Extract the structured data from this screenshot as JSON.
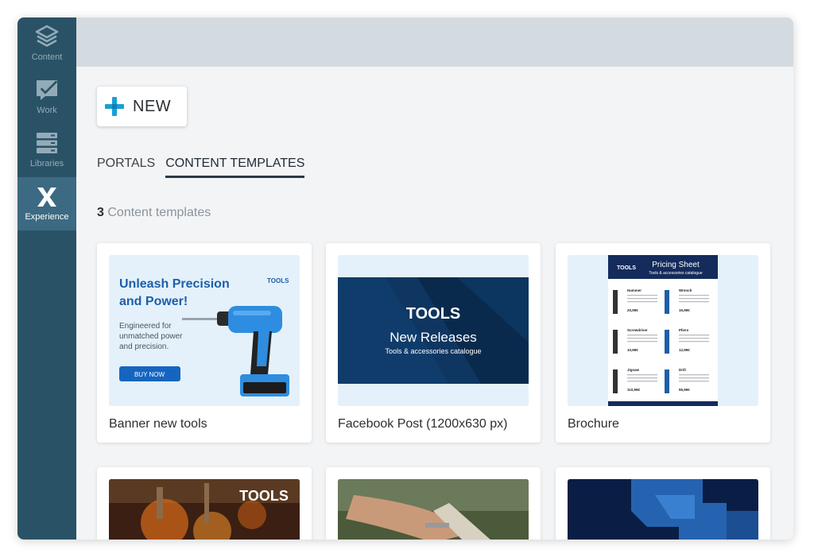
{
  "sidebar": {
    "items": [
      {
        "label": "Content",
        "icon": "layers-icon"
      },
      {
        "label": "Work",
        "icon": "checked-board-icon"
      },
      {
        "label": "Libraries",
        "icon": "stack-icon"
      },
      {
        "label": "Experience",
        "icon": "x-logo-icon",
        "active": true
      }
    ]
  },
  "toolbar": {
    "new_label": "NEW"
  },
  "tabs": [
    {
      "label": "PORTALS",
      "active": false
    },
    {
      "label": "CONTENT TEMPLATES",
      "active": true
    }
  ],
  "summary": {
    "count": "3",
    "label": "Content templates"
  },
  "cards": [
    {
      "title": "Banner new tools",
      "thumb": {
        "headline_1": "Unleash Precision",
        "headline_2": "and Power!",
        "brand": "TOOLS",
        "body_1": "Engineered for",
        "body_2": "unmatched power",
        "body_3": "and precision.",
        "cta": "BUY NOW"
      }
    },
    {
      "title": "Facebook Post (1200x630 px)",
      "thumb": {
        "brand": "TOOLS",
        "headline": "New Releases",
        "sub": "Tools & accessories catalogue"
      }
    },
    {
      "title": "Brochure",
      "thumb": {
        "brand": "TOOLS",
        "title": "Pricing Sheet",
        "sub": "Tools & accessories catalogue",
        "products": [
          "Hammer",
          "Wrench",
          "Screwdriver",
          "Pliers",
          "Jigsaw",
          "Drill"
        ],
        "prices": [
          "20,99€",
          "15,99€",
          "10,99€",
          "12,99€",
          "110,99€",
          "55,99€"
        ]
      }
    },
    {
      "title": "",
      "thumb": {
        "brand": "TOOLS"
      }
    },
    {
      "title": "",
      "thumb": {}
    },
    {
      "title": "",
      "thumb": {}
    }
  ],
  "colors": {
    "sidebar": "#2a5266",
    "sidebar_active": "#3b6a82",
    "accent": "#1a9fd6",
    "topbar": "#d4dbe0",
    "background": "#f3f4f6"
  }
}
